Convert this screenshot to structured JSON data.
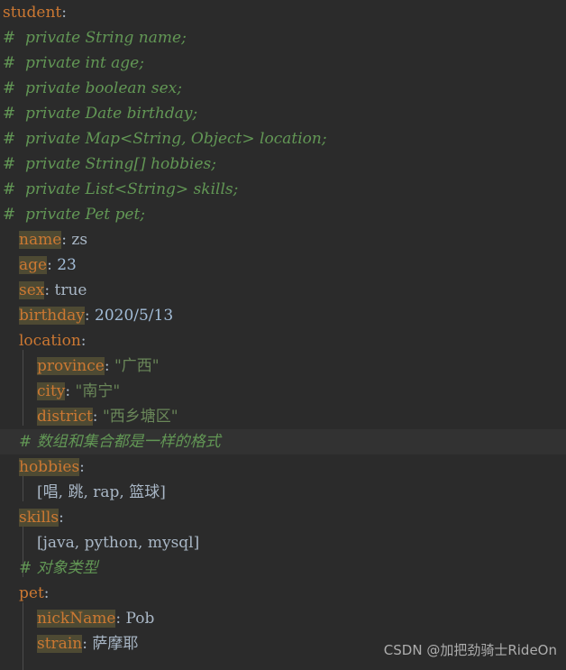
{
  "editor": {
    "background_color": "#2b2b2b",
    "current_line_color": "#323232",
    "key_highlight_color": "#4e4a33",
    "key_color": "#cc7832",
    "comment_color": "#629755",
    "value_color": "#a9b7c6",
    "string_color": "#6a8759",
    "number_color": "#a3bdd8"
  },
  "lines": [
    {
      "key": "student",
      "colon": ":",
      "value": ""
    },
    {
      "comment": "#  private String name;"
    },
    {
      "comment": "#  private int age;"
    },
    {
      "comment": "#  private boolean sex;"
    },
    {
      "comment": "#  private Date birthday;"
    },
    {
      "comment": "#  private Map<String, Object> location;"
    },
    {
      "comment": "#  private String[] hobbies;"
    },
    {
      "comment": "#  private List<String> skills;"
    },
    {
      "comment": "#  private Pet pet;"
    },
    {
      "key": "name",
      "colon": ":",
      "value": "zs"
    },
    {
      "key": "age",
      "colon": ":",
      "value": "23"
    },
    {
      "key": "sex",
      "colon": ":",
      "value": "true"
    },
    {
      "key": "birthday",
      "colon": ":",
      "value": "2020/5/13"
    },
    {
      "key": "location",
      "colon": ":",
      "value": ""
    },
    {
      "key": "province",
      "colon": ":",
      "value": "\"广西\""
    },
    {
      "key": "city",
      "colon": ":",
      "value": "\"南宁\""
    },
    {
      "key": "district",
      "colon": ":",
      "value": "\"西乡塘区\""
    },
    {
      "comment": "# 数组和集合都是一样的格式"
    },
    {
      "key": "hobbies",
      "colon": ":",
      "value": ""
    },
    {
      "value": "[唱, 跳, rap, 篮球]"
    },
    {
      "key": "skills",
      "colon": ":",
      "value": ""
    },
    {
      "value": "[java, python, mysql]"
    },
    {
      "comment": "# 对象类型"
    },
    {
      "key": "pet",
      "colon": ":",
      "value": ""
    },
    {
      "key": "nickName",
      "colon": ":",
      "value": "Pob"
    },
    {
      "key": "strain",
      "colon": ":",
      "value": "萨摩耶"
    }
  ],
  "watermark": {
    "text": "CSDN @加把劲骑士RideOn"
  }
}
